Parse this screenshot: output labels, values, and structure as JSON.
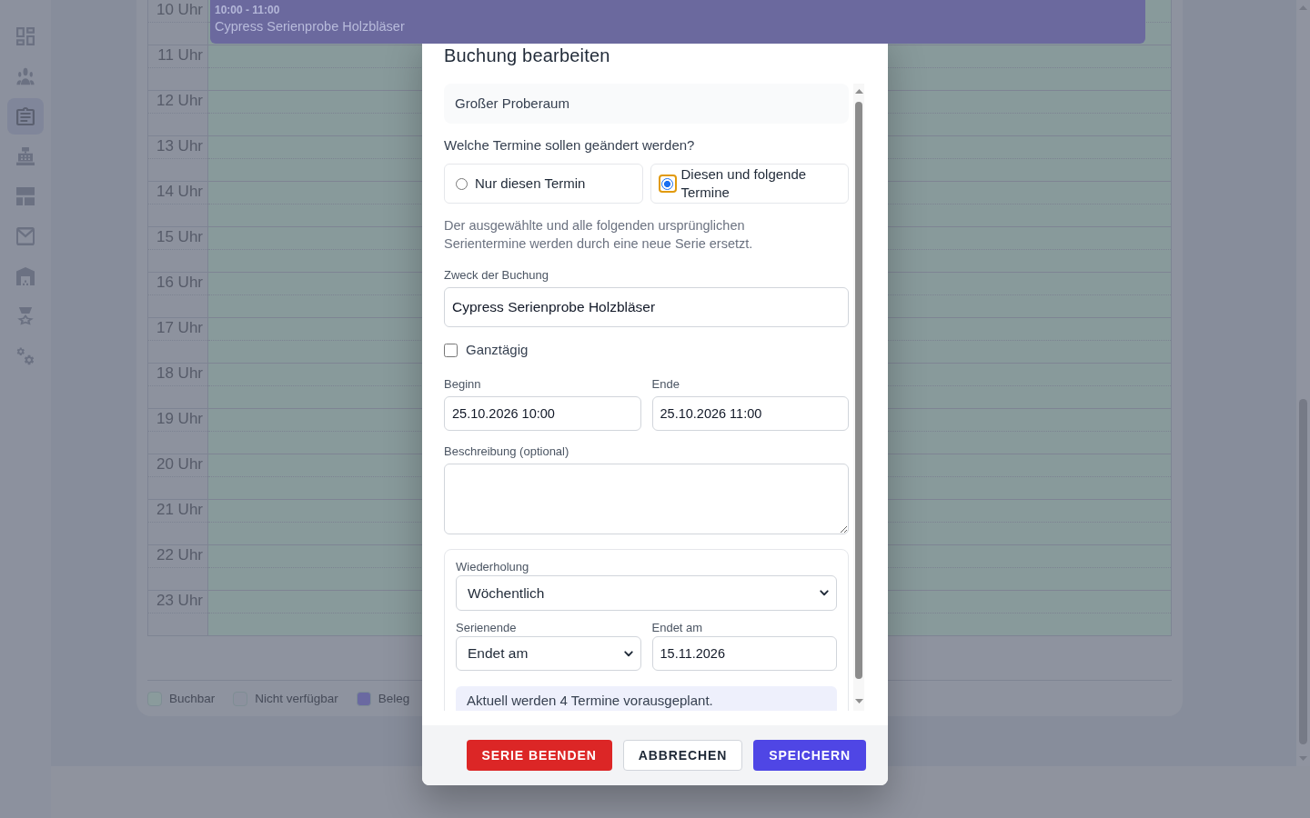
{
  "sidebar": {
    "items": [
      {
        "selected": false
      },
      {
        "selected": false
      },
      {
        "selected": true
      },
      {
        "selected": false
      },
      {
        "selected": false
      },
      {
        "selected": false
      },
      {
        "selected": false
      },
      {
        "selected": false
      },
      {
        "selected": false
      }
    ]
  },
  "calendar": {
    "rows": [
      {
        "label": "10 Uhr",
        "events": [
          {
            "time": "10:00 - 11:00",
            "title": "Cypress Serienprobe Holzbläser"
          }
        ]
      },
      {
        "label": "11 Uhr"
      },
      {
        "label": "12 Uhr"
      },
      {
        "label": "13 Uhr"
      },
      {
        "label": "14 Uhr"
      },
      {
        "label": "15 Uhr"
      },
      {
        "label": "16 Uhr"
      },
      {
        "label": "17 Uhr"
      },
      {
        "label": "18 Uhr"
      },
      {
        "label": "19 Uhr"
      },
      {
        "label": "20 Uhr"
      },
      {
        "label": "21 Uhr"
      },
      {
        "label": "22 Uhr"
      },
      {
        "label": "23 Uhr"
      }
    ],
    "legend": [
      {
        "label": "Buchbar",
        "color": "#8a9b9c"
      },
      {
        "label": "Nicht verfügbar",
        "color": "#8c919e"
      },
      {
        "label": "Beleg",
        "color": "#6a69a1"
      }
    ]
  },
  "dialog": {
    "title": "Buchung bearbeiten",
    "room": "Großer Proberaum",
    "scope": {
      "question": "Welche Termine sollen geändert werden?",
      "options": [
        {
          "label": "Nur diesen Termin",
          "selected": false,
          "focused": false
        },
        {
          "label": "Diesen und folgende Termine",
          "selected": true,
          "focused": true
        }
      ],
      "hint": "Der ausgewählte und alle folgenden ursprünglichen Serientermine werden durch eine neue Serie ersetzt."
    },
    "purpose": {
      "label": "Zweck der Buchung",
      "value": "Cypress Serienprobe Holzbläser"
    },
    "all_day": {
      "label": "Ganztägig",
      "checked": false
    },
    "start": {
      "label": "Beginn",
      "value": "25.10.2026 10:00"
    },
    "end": {
      "label": "Ende",
      "value": "25.10.2026 11:00"
    },
    "description": {
      "label": "Beschreibung (optional)"
    },
    "recurrence": {
      "repeat": {
        "label": "Wiederholung",
        "value": "Wöchentlich"
      },
      "series_end": {
        "label": "Serienende",
        "value": "Endet am"
      },
      "end_date": {
        "label": "Endet am",
        "value": "15.11.2026"
      },
      "info": "Aktuell werden 4 Termine vorausgeplant."
    },
    "buttons": [
      {
        "label": "SERIE BEENDEN",
        "kind": "danger"
      },
      {
        "label": "ABBRECHEN",
        "kind": "secondary"
      },
      {
        "label": "SPEICHERN",
        "kind": "primary"
      }
    ]
  }
}
